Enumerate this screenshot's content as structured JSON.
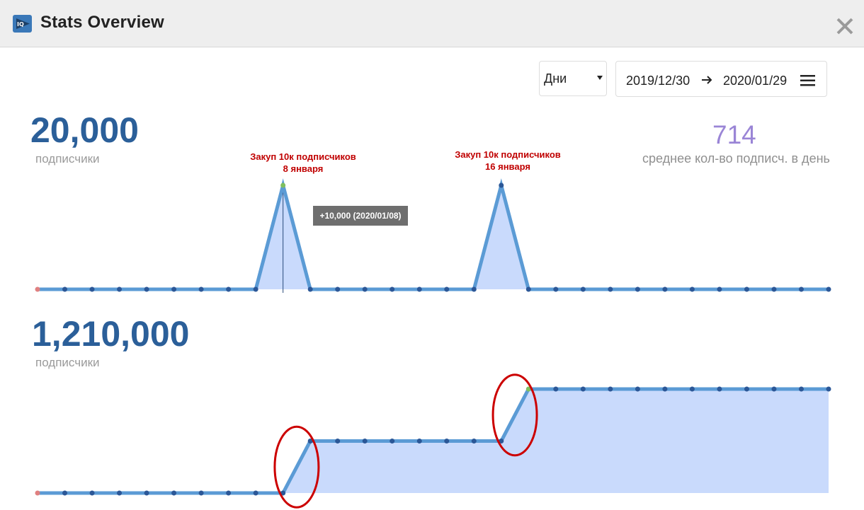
{
  "window": {
    "title": "Stats Overview",
    "app_icon": "iq-logo-icon",
    "close_icon": "close-icon"
  },
  "controls": {
    "period_value": "Дни",
    "date_from": "2019/12/30",
    "date_to": "2020/01/29",
    "range_arrow_icon": "arrow-right-icon",
    "menu_icon": "hamburger-menu-icon"
  },
  "top_stats": {
    "total_value": "20,000",
    "total_label": "подписчики",
    "avg_value": "714",
    "avg_label": "среднее кол-во подписч. в день"
  },
  "bottom_stats": {
    "total_value": "1,210,000",
    "total_label": "подписчики"
  },
  "annotations": [
    {
      "line1": "Закуп 10к подписчиков",
      "line2": "8 января"
    },
    {
      "line1": "Закуп 10к подписчиков",
      "line2": "16 января"
    }
  ],
  "tooltip": {
    "text": "+10,000 (2020/01/08)"
  },
  "colors": {
    "line": "#5b9bd5",
    "fill": "#c9dafc",
    "point": "#2b5797",
    "start_point": "#e08080",
    "highlight_point": "#7fbf5f",
    "highlight_circle": "#cc0000",
    "big_number": "#2b5f99",
    "avg_number": "#9a85d6"
  },
  "chart_data": [
    {
      "type": "area",
      "x": [
        "2019/12/30",
        "2019/12/31",
        "2020/01/01",
        "2020/01/02",
        "2020/01/03",
        "2020/01/04",
        "2020/01/05",
        "2020/01/06",
        "2020/01/07",
        "2020/01/08",
        "2020/01/09",
        "2020/01/10",
        "2020/01/11",
        "2020/01/12",
        "2020/01/13",
        "2020/01/14",
        "2020/01/15",
        "2020/01/16",
        "2020/01/17",
        "2020/01/18",
        "2020/01/19",
        "2020/01/20",
        "2020/01/21",
        "2020/01/22",
        "2020/01/23",
        "2020/01/24",
        "2020/01/25",
        "2020/01/26",
        "2020/01/27",
        "2020/01/28"
      ],
      "series": [
        {
          "values": [
            0,
            0,
            0,
            0,
            0,
            0,
            0,
            0,
            0,
            10000,
            0,
            0,
            0,
            0,
            0,
            0,
            0,
            10000,
            0,
            0,
            0,
            0,
            0,
            0,
            0,
            0,
            0,
            0,
            0,
            0
          ]
        }
      ],
      "highlight_index": 9
    },
    {
      "type": "area",
      "x": [
        "2019/12/30",
        "2019/12/31",
        "2020/01/01",
        "2020/01/02",
        "2020/01/03",
        "2020/01/04",
        "2020/01/05",
        "2020/01/06",
        "2020/01/07",
        "2020/01/08",
        "2020/01/09",
        "2020/01/10",
        "2020/01/11",
        "2020/01/12",
        "2020/01/13",
        "2020/01/14",
        "2020/01/15",
        "2020/01/16",
        "2020/01/17",
        "2020/01/18",
        "2020/01/19",
        "2020/01/20",
        "2020/01/21",
        "2020/01/22",
        "2020/01/23",
        "2020/01/24",
        "2020/01/25",
        "2020/01/26",
        "2020/01/27",
        "2020/01/28"
      ],
      "series": [
        {
          "values": [
            1190000,
            1190000,
            1190000,
            1190000,
            1190000,
            1190000,
            1190000,
            1190000,
            1190000,
            1190000,
            1200000,
            1200000,
            1200000,
            1200000,
            1200000,
            1200000,
            1200000,
            1200000,
            1210000,
            1210000,
            1210000,
            1210000,
            1210000,
            1210000,
            1210000,
            1210000,
            1210000,
            1210000,
            1210000,
            1210000
          ]
        }
      ],
      "circled_steps": [
        9,
        17
      ],
      "highlight_index": 18
    }
  ]
}
